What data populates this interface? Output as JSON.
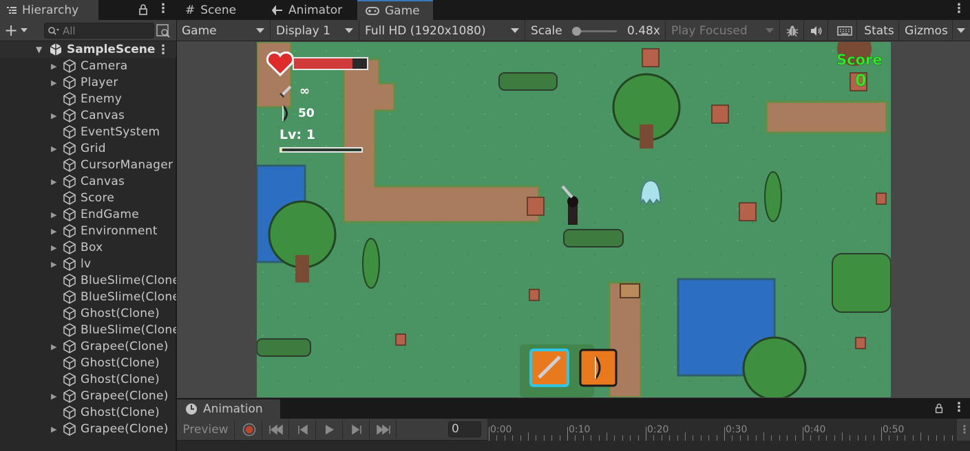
{
  "hierarchy": {
    "tab_label": "Hierarchy",
    "search_placeholder": "All",
    "scene_name": "SampleScene",
    "items": [
      {
        "label": "Camera",
        "expandable": true
      },
      {
        "label": "Player",
        "expandable": true
      },
      {
        "label": "Enemy",
        "expandable": false
      },
      {
        "label": "Canvas",
        "expandable": true
      },
      {
        "label": "EventSystem",
        "expandable": false
      },
      {
        "label": "Grid",
        "expandable": true
      },
      {
        "label": "CursorManager",
        "expandable": false
      },
      {
        "label": "Canvas",
        "expandable": true
      },
      {
        "label": "Score",
        "expandable": false
      },
      {
        "label": "EndGame",
        "expandable": true
      },
      {
        "label": "Environment",
        "expandable": true
      },
      {
        "label": "Box",
        "expandable": true
      },
      {
        "label": "lv",
        "expandable": true
      },
      {
        "label": "BlueSlime(Clone)",
        "expandable": false
      },
      {
        "label": "BlueSlime(Clone)",
        "expandable": false
      },
      {
        "label": "Ghost(Clone)",
        "expandable": false
      },
      {
        "label": "BlueSlime(Clone)",
        "expandable": false
      },
      {
        "label": "Grapee(Clone)",
        "expandable": true
      },
      {
        "label": "Ghost(Clone)",
        "expandable": false
      },
      {
        "label": "Ghost(Clone)",
        "expandable": false
      },
      {
        "label": "Grapee(Clone)",
        "expandable": true
      },
      {
        "label": "Ghost(Clone)",
        "expandable": false
      },
      {
        "label": "Grapee(Clone)",
        "expandable": true
      }
    ]
  },
  "tabs": [
    {
      "label": "Scene",
      "icon": "grid-hash-icon"
    },
    {
      "label": "Animator",
      "icon": "animator-icon"
    },
    {
      "label": "Game",
      "icon": "gamepad-icon",
      "active": true
    }
  ],
  "game_toolbar": {
    "view_mode": "Game",
    "display": "Display 1",
    "resolution": "Full HD (1920x1080)",
    "scale_label": "Scale",
    "scale_value": "0.48x",
    "scale_fraction": 0.02,
    "play_mode": "Play Focused",
    "stats_label": "Stats",
    "gizmos_label": "Gizmos"
  },
  "game_hud": {
    "health_fraction": 0.8,
    "attack_value": "∞",
    "arrows_value": "50",
    "level_label": "Lv: 1",
    "xp_fraction": 0.02,
    "score_label": "Score",
    "score_value": "0"
  },
  "animation": {
    "tab_label": "Animation",
    "preview_label": "Preview",
    "frame_value": "0",
    "timeline_labels": [
      "0:00",
      "0:10",
      "0:20",
      "0:30",
      "0:40",
      "0:50"
    ]
  },
  "colors": {
    "grass": "#4a9363",
    "path": "#a97c5d",
    "water": "#2c6fc2",
    "score_green": "#34e82a",
    "active_tab_accent": "#3a79bb"
  }
}
